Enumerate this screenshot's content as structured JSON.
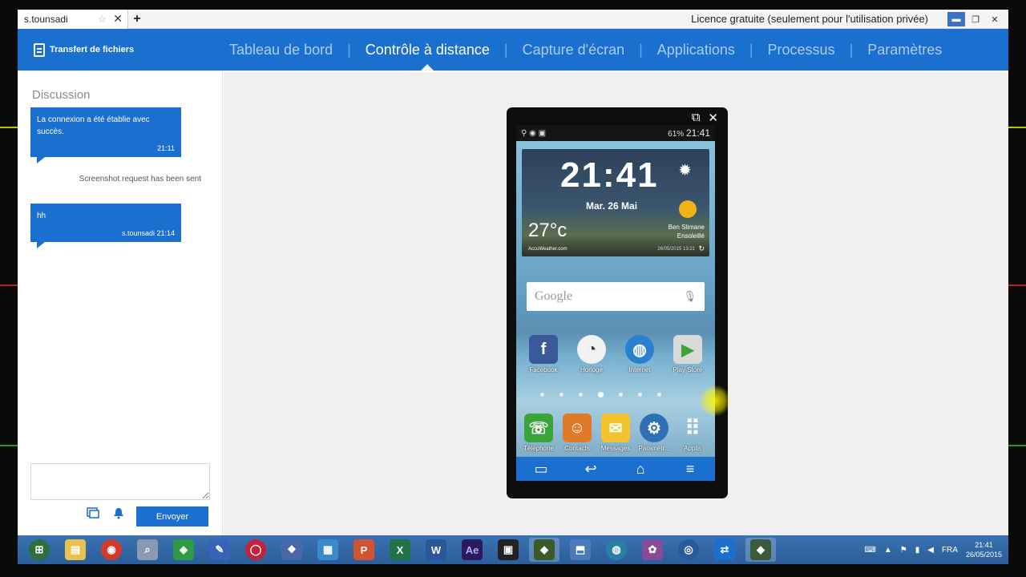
{
  "browser": {
    "tab_title": "s.tounsadi",
    "star_glyph": "☆",
    "close_glyph": "✕",
    "new_tab_glyph": "+",
    "licence": "Licence gratuite (seulement pour l'utilisation privée)",
    "min_glyph": "▬",
    "restore_glyph": "❐",
    "close_window_glyph": "✕"
  },
  "header": {
    "brand": "Transfert de fichiers",
    "nav": [
      {
        "label": "Tableau de bord",
        "active": false
      },
      {
        "label": "Contrôle à distance",
        "active": true
      },
      {
        "label": "Capture d'écran",
        "active": false
      },
      {
        "label": "Applications",
        "active": false
      },
      {
        "label": "Processus",
        "active": false
      },
      {
        "label": "Paramètres",
        "active": false
      }
    ]
  },
  "chat": {
    "title": "Discussion",
    "messages": [
      {
        "text": "La connexion a été établie avec succès.",
        "time": "21:11"
      },
      {
        "system": "Screenshot request has been sent"
      },
      {
        "text": "hh",
        "time": "s.tounsadi 21:14"
      }
    ],
    "input_value": "",
    "send_label": "Envoyer"
  },
  "phone": {
    "popout_glyph": "⧉",
    "close_glyph": "✕",
    "status_clock": "21:41",
    "status_battery": "61%",
    "weather": {
      "time": "21:41",
      "date": "Mar. 26 Mai",
      "temp": "27°c",
      "city": "Ben Slimane",
      "condition": "Ensoleillé",
      "brand": "AccuWeather.com",
      "updated": "26/05/2015 13:21"
    },
    "search_placeholder": "Google",
    "apps_row1": [
      {
        "label": "Facebook",
        "glyph": "f",
        "color": "#3b5998",
        "icon": "facebook-icon"
      },
      {
        "label": "Horloge",
        "glyph": "◔",
        "color": "#e8e8e8",
        "icon": "clock-icon"
      },
      {
        "label": "Internet",
        "glyph": "◍",
        "color": "#2a7fd1",
        "icon": "globe-icon"
      },
      {
        "label": "Play Store",
        "glyph": "▶",
        "color": "#c9c9c9",
        "icon": "play-store-icon"
      }
    ],
    "apps_row2": [
      {
        "label": "Téléphone",
        "glyph": "☏",
        "color": "#3aa33a",
        "icon": "phone-icon"
      },
      {
        "label": "Contacts",
        "glyph": "☺",
        "color": "#e07a2a",
        "icon": "contacts-icon"
      },
      {
        "label": "Messages",
        "glyph": "✉",
        "color": "#f4c430",
        "icon": "messages-icon"
      },
      {
        "label": "Paramètr...",
        "glyph": "⚙",
        "color": "#2f6fb5",
        "icon": "settings-icon"
      },
      {
        "label": "Applis",
        "glyph": "⠿",
        "color": "#4a5a6a",
        "icon": "apps-grid-icon"
      }
    ],
    "page_dots": 7,
    "active_dot": 3,
    "nav": {
      "menu": "▭",
      "back": "↩",
      "home": "⌂",
      "recent": "≡"
    }
  },
  "taskbar": {
    "items": [
      {
        "icon": "start-orb-icon",
        "glyph": "⊞",
        "color": "#2c6e3c"
      },
      {
        "icon": "file-explorer-icon",
        "glyph": "▤",
        "color": "#e8c24a"
      },
      {
        "icon": "chrome-icon",
        "glyph": "◉",
        "color": "#d43a2a"
      },
      {
        "icon": "search-tool-icon",
        "glyph": "⌕",
        "color": "#8a9ab0"
      },
      {
        "icon": "network-icon",
        "glyph": "◈",
        "color": "#2e9a44"
      },
      {
        "icon": "paint-icon",
        "glyph": "✎",
        "color": "#3a62b8"
      },
      {
        "icon": "opera-icon",
        "glyph": "◯",
        "color": "#c8203a"
      },
      {
        "icon": "virtualbox-icon",
        "glyph": "❖",
        "color": "#4a68a8"
      },
      {
        "icon": "layers-icon",
        "glyph": "▦",
        "color": "#3a8acb"
      },
      {
        "icon": "powerpoint-icon",
        "glyph": "P",
        "color": "#d35230"
      },
      {
        "icon": "excel-icon",
        "glyph": "X",
        "color": "#217346"
      },
      {
        "icon": "word-icon",
        "glyph": "W",
        "color": "#2b579a"
      },
      {
        "icon": "after-effects-icon",
        "glyph": "Ae",
        "color": "#2a1a5e"
      },
      {
        "icon": "media-player-icon",
        "glyph": "▣",
        "color": "#222222"
      },
      {
        "icon": "android-app-icon",
        "glyph": "◆",
        "color": "#3a5a2a"
      },
      {
        "icon": "installer-icon",
        "glyph": "⬒",
        "color": "#4a7ab8"
      },
      {
        "icon": "network-globe-icon",
        "glyph": "◍",
        "color": "#2a7fa8"
      },
      {
        "icon": "tools-icon",
        "glyph": "✿",
        "color": "#8a4a9a"
      },
      {
        "icon": "shield-app-icon",
        "glyph": "◎",
        "color": "#2a5a9a"
      },
      {
        "icon": "teamviewer-icon",
        "glyph": "⇄",
        "color": "#1a6fcf"
      },
      {
        "icon": "airdroid-icon",
        "glyph": "◆",
        "color": "#3a5a3a"
      }
    ],
    "tray": {
      "lang": "FRA",
      "time": "21:41",
      "date": "26/05/2015"
    }
  }
}
